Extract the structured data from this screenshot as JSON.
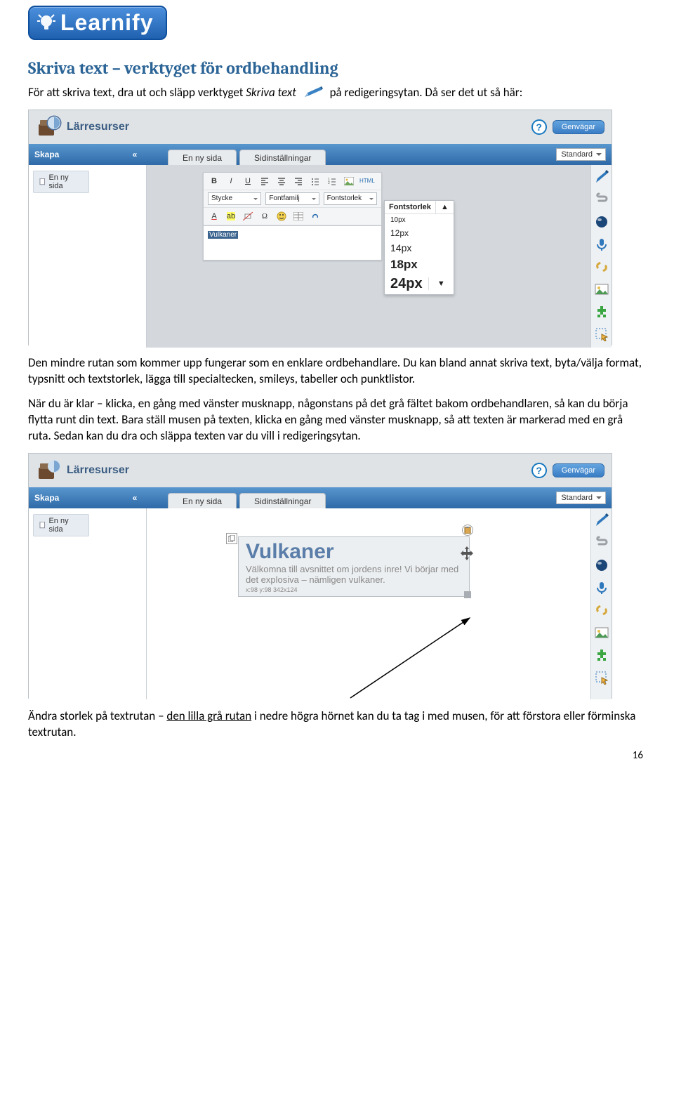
{
  "logo_text": "Learnify",
  "heading": "Skriva text – verktyget för ordbehandling",
  "p1a": "För att skriva text, dra ut och släpp verktyget ",
  "p1b": "Skriva text",
  "p1c": " på redigeringsytan. Då ser det ut så här:",
  "p2": "Den mindre rutan som kommer upp fungerar som en enklare ordbehandlare. Du kan bland annat skriva text, byta/välja format, typsnitt och textstorlek, lägga till specialtecken, smileys, tabeller och punktlistor.",
  "p3": "När du är klar – klicka, en gång med vänster musknapp, någonstans på det grå fältet bakom ordbehandlaren, så kan du börja flytta runt din text. Bara ställ musen på texten, klicka en gång med vänster musknapp, så att texten är markerad med en grå ruta. Sedan kan du dra och släppa texten var du vill i redigeringsytan.",
  "p4a": "Ändra storlek på textrutan – ",
  "p4u": "den lilla grå rutan",
  "p4b": " i nedre högra hörnet kan du ta tag i med musen, för att förstora eller förminska textrutan.",
  "page_number": "16",
  "screenshot": {
    "banner_title": "Lärresurser",
    "shortcuts_label": "Genvägar",
    "stripe_label": "Skapa",
    "tab_new_page": "En ny sida",
    "tab_settings": "Sidinställningar",
    "layout_select": "Standard",
    "side_item": "En ny sida",
    "editor": {
      "dd_style": "Stycke",
      "dd_font": "Fontfamilj",
      "dd_size": "Fontstorlek",
      "typed_text": "Vulkaner",
      "html_label": "HTML"
    },
    "fontsize_popup": {
      "title": "Fontstorlek",
      "s1": "10px",
      "s2": "12px",
      "s3": "14px",
      "s4": "18px",
      "s5": "24px"
    },
    "textblock": {
      "title": "Vulkaner",
      "body": "Välkomna till avsnittet om jordens inre! Vi börjar med det explosiva – nämligen vulkaner.",
      "meta": "x:98 y:98 342x124"
    }
  }
}
